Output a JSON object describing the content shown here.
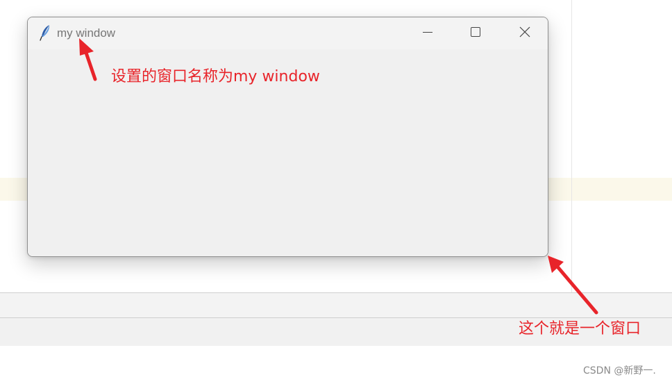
{
  "window": {
    "title": "my window",
    "controls": {
      "minimize_icon": "minimize-icon",
      "maximize_icon": "maximize-icon",
      "close_icon": "close-icon"
    },
    "app_icon": "feather-icon"
  },
  "annotations": {
    "title_note": "设置的窗口名称为my window",
    "window_note": "这个就是一个窗口",
    "color": "#e8242a"
  },
  "watermark": "CSDN @新野一."
}
